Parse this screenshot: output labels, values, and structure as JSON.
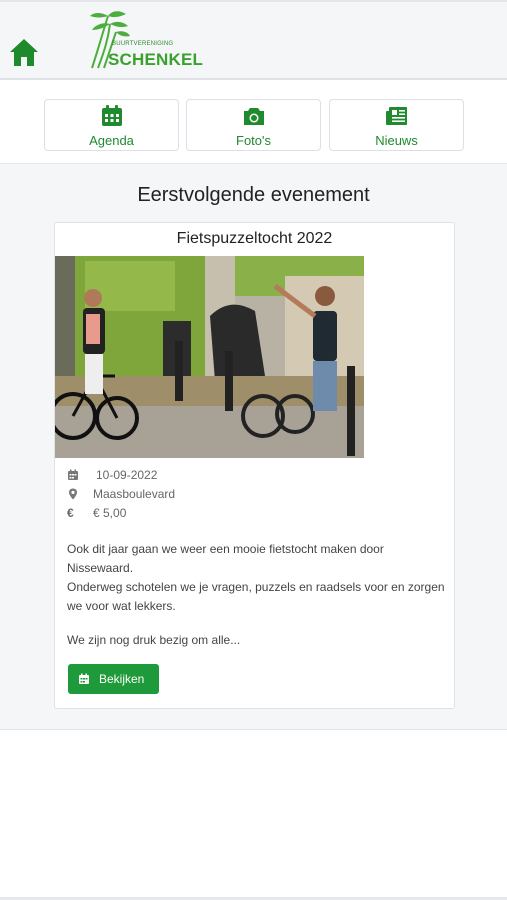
{
  "header": {
    "home_icon": "home-icon",
    "logo": {
      "small_text": "BUURTVERENIGING",
      "big_text": "SCHENKEL",
      "colors": {
        "primary": "#3aa02e",
        "dark": "#2e8b2e"
      }
    }
  },
  "nav": {
    "items": [
      {
        "label": "Agenda",
        "icon": "calendar-icon"
      },
      {
        "label": "Foto's",
        "icon": "camera-icon"
      },
      {
        "label": "Nieuws",
        "icon": "newspaper-icon"
      }
    ],
    "accent": "#1f8a2e"
  },
  "main": {
    "section_title": "Eerstvolgende evenement",
    "event": {
      "title": "Fietspuzzeltocht 2022",
      "date": "10-09-2022",
      "location": "Maasboulevard",
      "price": "€ 5,00",
      "description_1": "Ook dit jaar gaan we weer een mooie fietstocht maken door Nissewaard.",
      "description_2": "Onderweg schotelen we je vragen, puzzels en raadsels voor en zorgen we voor wat lekkers.",
      "description_3": "We zijn nog druk bezig om alle...",
      "button_label": "Bekijken",
      "button_color": "#1f9a3a"
    }
  }
}
